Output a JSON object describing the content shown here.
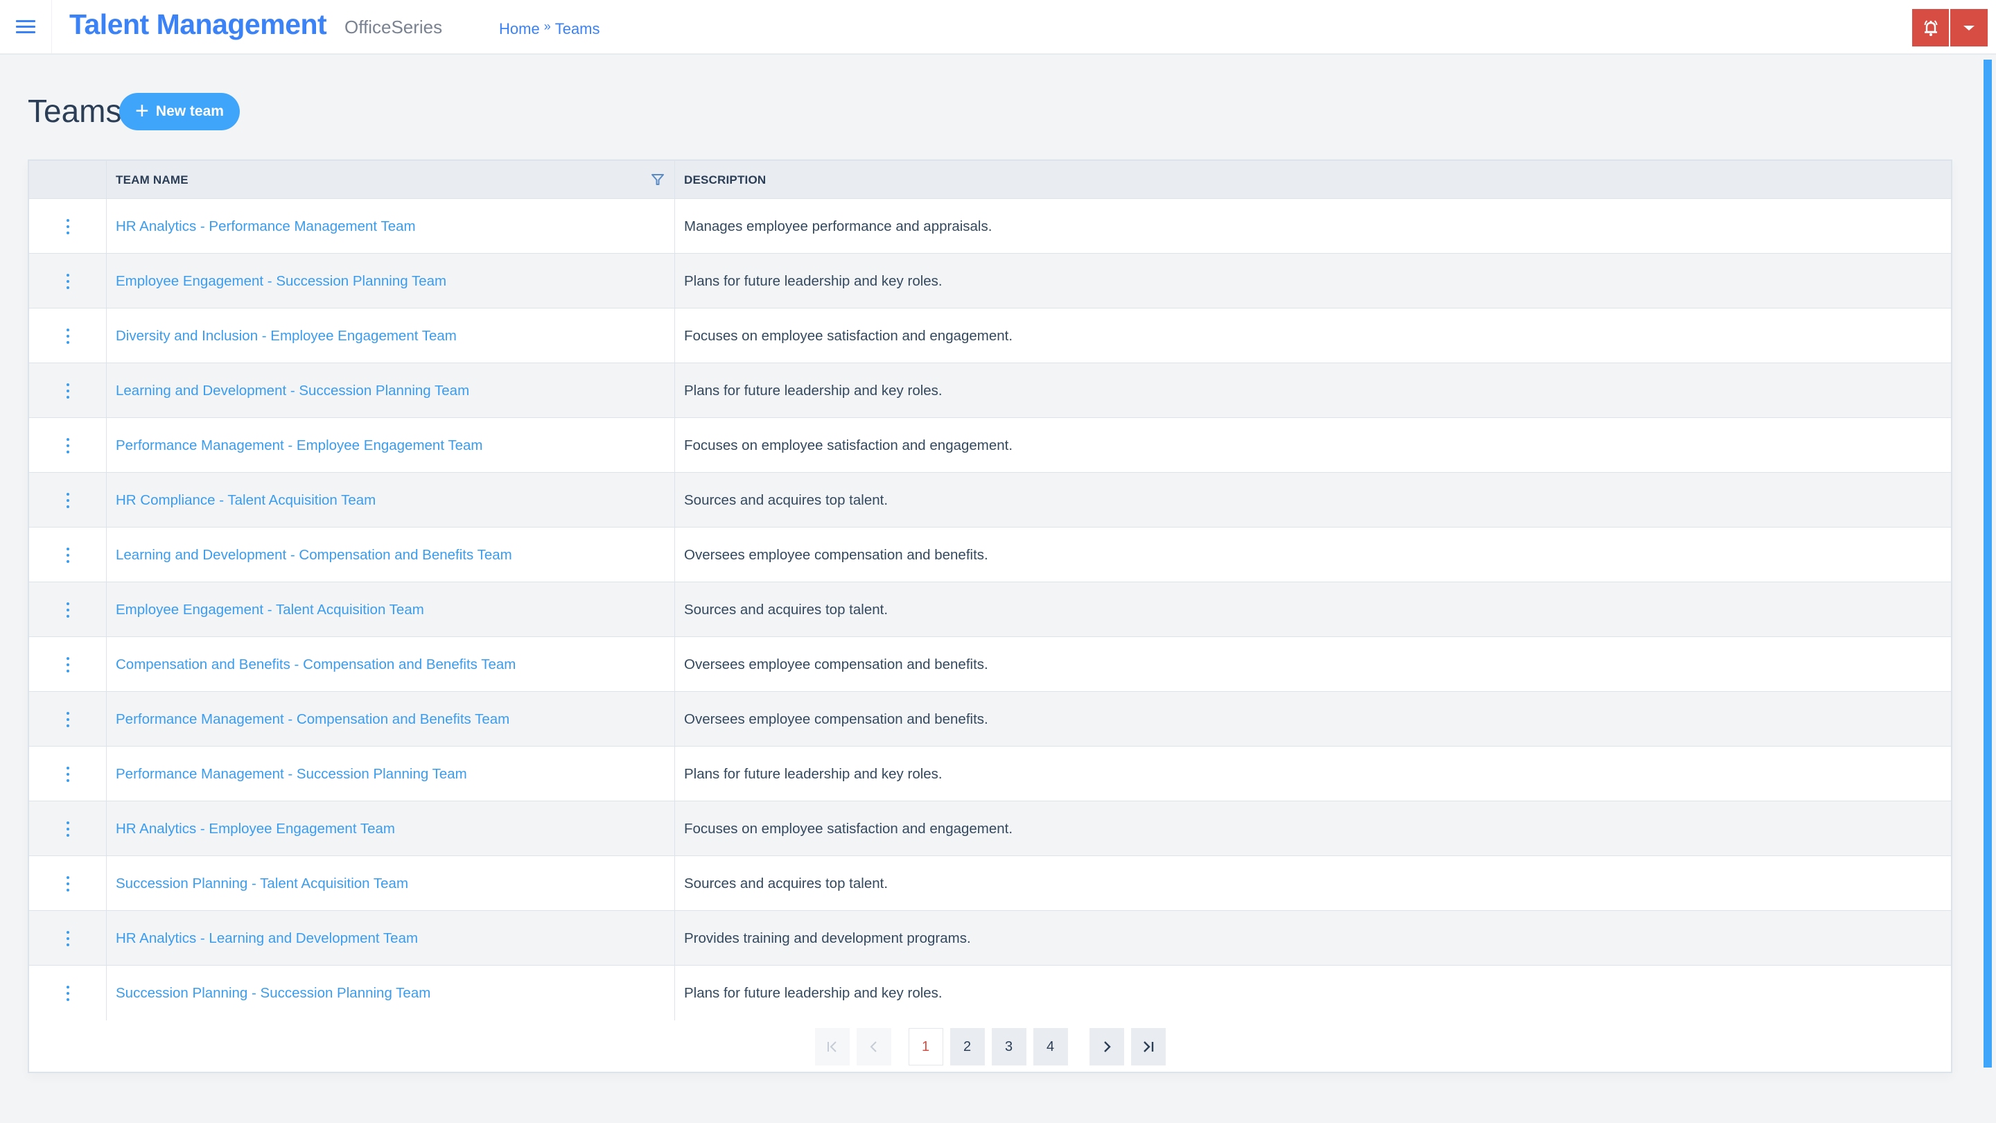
{
  "header": {
    "app_title": "Talent Management",
    "suite_name": "OfficeSeries",
    "breadcrumb": [
      {
        "label": "Home"
      },
      {
        "label": "Teams"
      }
    ],
    "breadcrumb_separator": "»",
    "icons": {
      "menu": "hamburger-menu-icon",
      "alerts": "bell-ringing-icon",
      "dropdown": "caret-down-icon"
    },
    "accent_color": "#3b82f6",
    "alert_button_color": "#d74d43"
  },
  "page": {
    "title": "Teams",
    "new_button_label": "New team",
    "new_button_color": "#3fa5fb"
  },
  "table": {
    "columns": [
      {
        "key": "actions",
        "label": ""
      },
      {
        "key": "team_name",
        "label": "TEAM NAME",
        "filterable": true
      },
      {
        "key": "description",
        "label": "DESCRIPTION"
      }
    ],
    "rows": [
      {
        "team_name": "HR Analytics - Performance Management Team",
        "description": "Manages employee performance and appraisals."
      },
      {
        "team_name": "Employee Engagement - Succession Planning Team",
        "description": "Plans for future leadership and key roles."
      },
      {
        "team_name": "Diversity and Inclusion - Employee Engagement Team",
        "description": "Focuses on employee satisfaction and engagement."
      },
      {
        "team_name": "Learning and Development - Succession Planning Team",
        "description": "Plans for future leadership and key roles."
      },
      {
        "team_name": "Performance Management - Employee Engagement Team",
        "description": "Focuses on employee satisfaction and engagement."
      },
      {
        "team_name": "HR Compliance - Talent Acquisition Team",
        "description": "Sources and acquires top talent."
      },
      {
        "team_name": "Learning and Development - Compensation and Benefits Team",
        "description": "Oversees employee compensation and benefits."
      },
      {
        "team_name": "Employee Engagement - Talent Acquisition Team",
        "description": "Sources and acquires top talent."
      },
      {
        "team_name": "Compensation and Benefits - Compensation and Benefits Team",
        "description": "Oversees employee compensation and benefits."
      },
      {
        "team_name": "Performance Management - Compensation and Benefits Team",
        "description": "Oversees employee compensation and benefits."
      },
      {
        "team_name": "Performance Management - Succession Planning Team",
        "description": "Plans for future leadership and key roles."
      },
      {
        "team_name": "HR Analytics - Employee Engagement Team",
        "description": "Focuses on employee satisfaction and engagement."
      },
      {
        "team_name": "Succession Planning - Talent Acquisition Team",
        "description": "Sources and acquires top talent."
      },
      {
        "team_name": "HR Analytics - Learning and Development Team",
        "description": "Provides training and development programs."
      },
      {
        "team_name": "Succession Planning - Succession Planning Team",
        "description": "Plans for future leadership and key roles."
      }
    ],
    "link_color": "#3b9ced"
  },
  "pagination": {
    "current_page": 1,
    "pages": [
      "1",
      "2",
      "3",
      "4"
    ],
    "first_label": "|<",
    "prev_label": "<",
    "next_label": ">",
    "last_label": ">|",
    "first_disabled": true,
    "prev_disabled": true,
    "active_color": "#d74d43"
  }
}
